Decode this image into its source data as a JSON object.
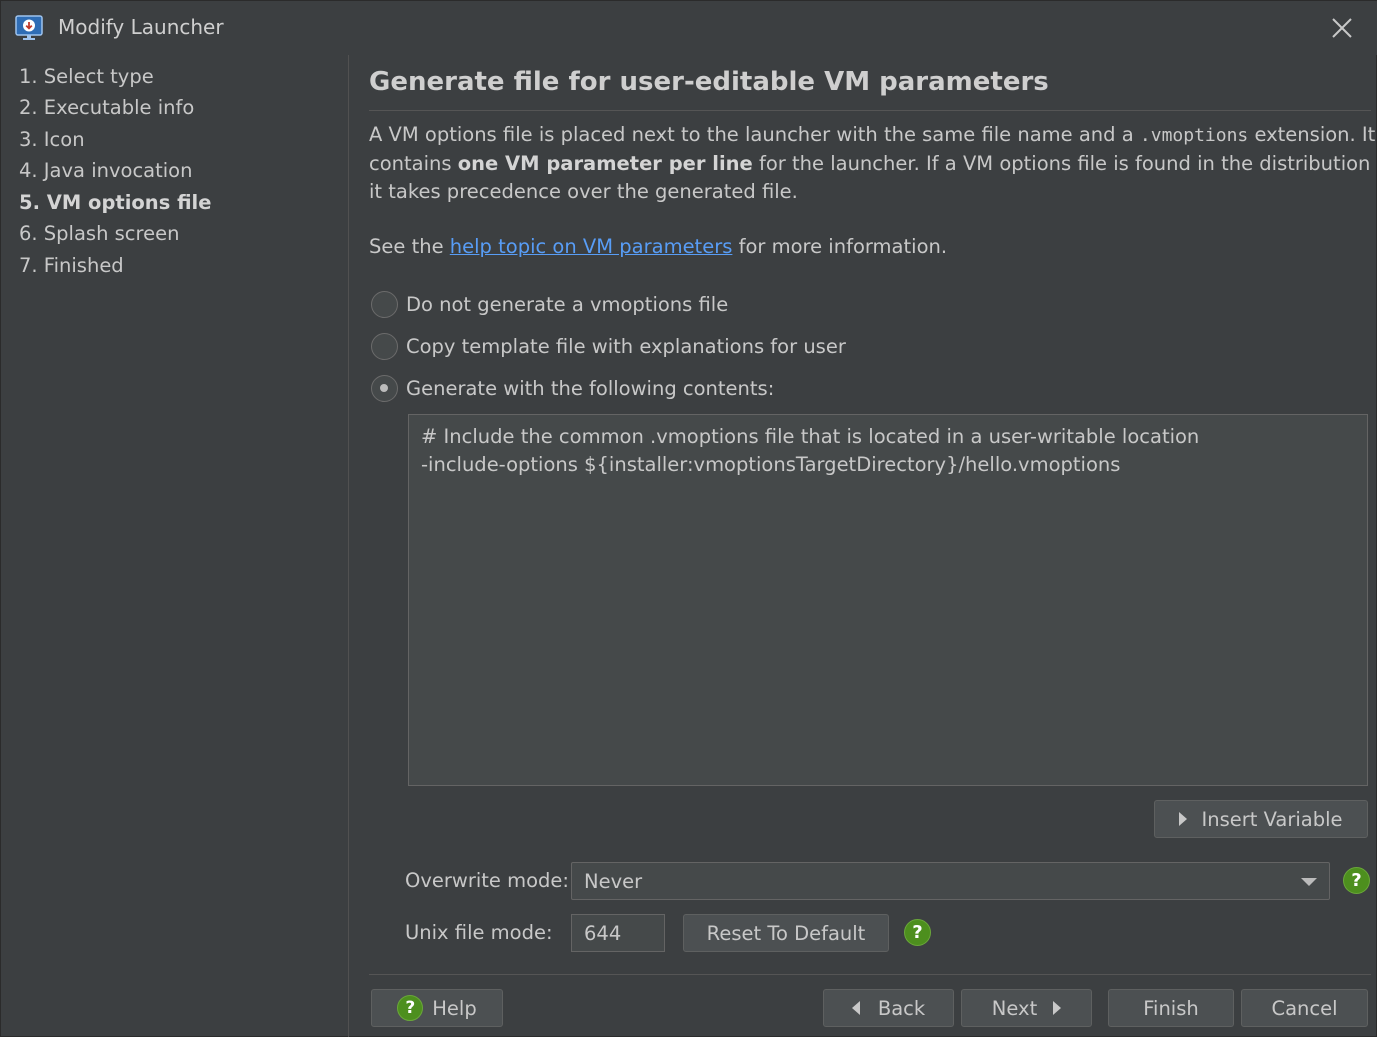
{
  "window": {
    "title": "Modify Launcher",
    "app_icon": "launcher-monitor-icon",
    "close_icon": "close-icon"
  },
  "sidebar": {
    "steps": [
      {
        "label": "1. Select type",
        "active": false
      },
      {
        "label": "2. Executable info",
        "active": false
      },
      {
        "label": "3. Icon",
        "active": false
      },
      {
        "label": "4. Java invocation",
        "active": false
      },
      {
        "label": "5. VM options file",
        "active": true
      },
      {
        "label": "6. Splash screen",
        "active": false
      },
      {
        "label": "7. Finished",
        "active": false
      }
    ]
  },
  "main": {
    "heading": "Generate file for user-editable VM parameters",
    "description": {
      "line1_a": "A VM options file is placed next to the launcher with the same file name and a ",
      "line1_code": ".vmoptions",
      "line1_b": " extension. It",
      "line2_a": "contains ",
      "line2_bold": "one VM parameter per line",
      "line2_b": " for the launcher. If a VM options file is found in the distribution tree,",
      "line3": "it takes precedence over the generated file."
    },
    "see_also": {
      "prefix": "See the ",
      "link": "help topic on VM parameters",
      "suffix": " for more information."
    },
    "options": [
      {
        "label": "Do not generate a vmoptions file",
        "checked": false
      },
      {
        "label": "Copy template file with explanations for user",
        "checked": false
      },
      {
        "label": "Generate with the following contents:",
        "checked": true
      }
    ],
    "contents": "# Include the common .vmoptions file that is located in a user-writable location\n-include-options ${installer:vmoptionsTargetDirectory}/hello.vmoptions",
    "insert_variable_label": "Insert Variable",
    "overwrite_mode": {
      "label": "Overwrite mode:",
      "value": "Never"
    },
    "unix_file_mode": {
      "label": "Unix file mode:",
      "value": "644",
      "reset_label": "Reset To Default"
    },
    "help_badge_glyph": "?"
  },
  "footer": {
    "help_label": "Help",
    "back_label": "Back",
    "next_label": "Next",
    "finish_label": "Finish",
    "cancel_label": "Cancel"
  },
  "colors": {
    "background": "#3c3f41",
    "text": "#c8c8c8",
    "link": "#589df6",
    "help_green": "#4d8f1e",
    "field_bg": "#45494a"
  }
}
